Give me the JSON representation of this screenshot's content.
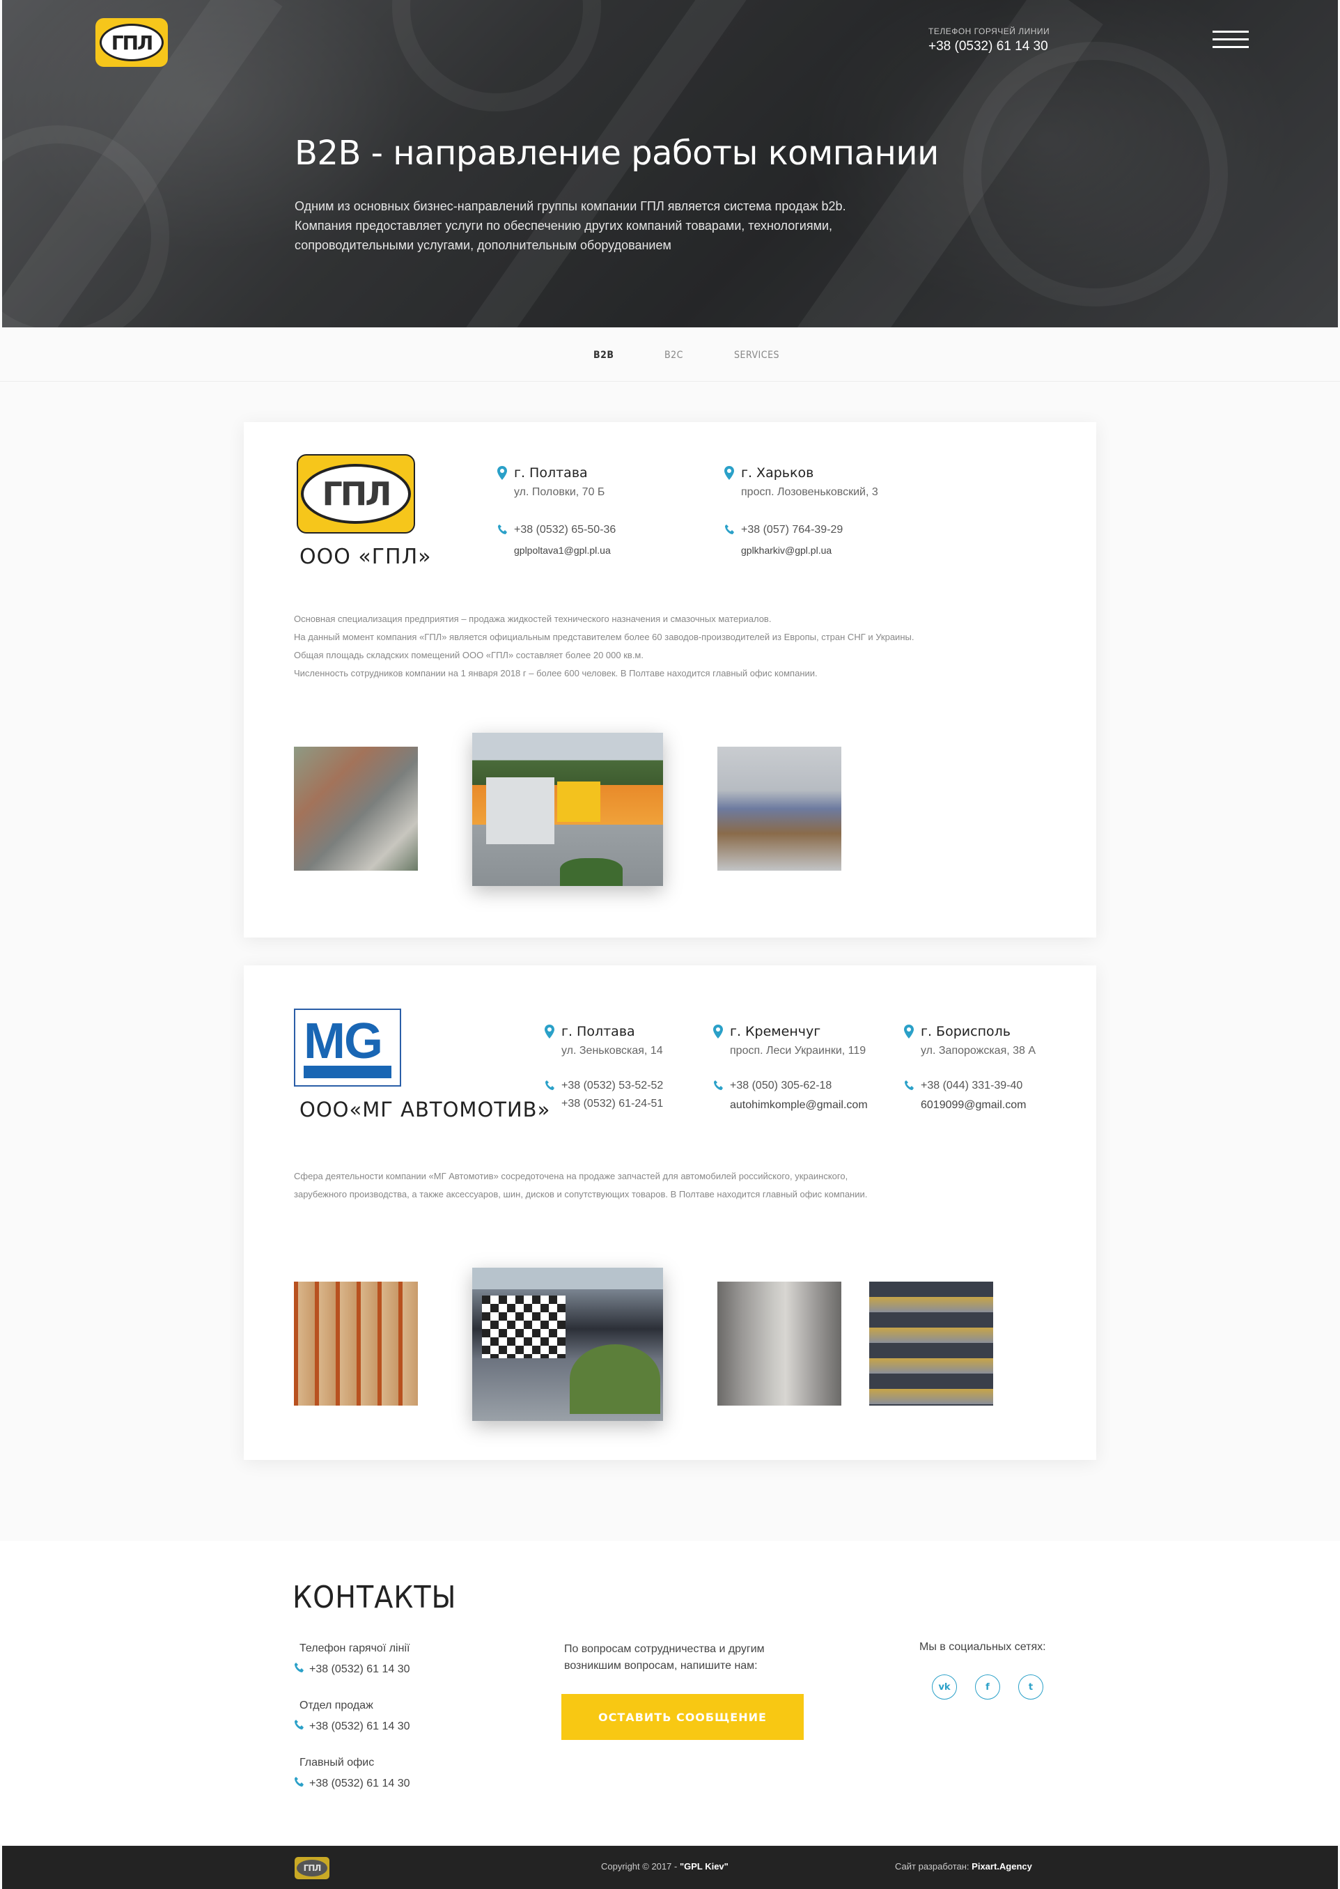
{
  "header": {
    "logo_text": "ГПЛ",
    "hotline_caption": "ТЕЛЕФОН ГОРЯЧЕЙ ЛИНИИ",
    "hotline_phone": "+38 (0532) 61 14 30",
    "title": "B2B - направление работы компании",
    "text": "Одним из основных бизнес-направлений группы компании ГПЛ является система продаж b2b. Компания предоставляет услуги по обеспечению других компаний товарами, технологиями, сопроводительными услугами, дополнительным оборудованием"
  },
  "tabs": [
    {
      "label": "B2B",
      "active": true
    },
    {
      "label": "B2C",
      "active": false
    },
    {
      "label": "SERVICES",
      "active": false
    }
  ],
  "company1": {
    "logo_text": "ГПЛ",
    "name": "ООО «ГПЛ»",
    "locations": [
      {
        "city": "г. Полтава",
        "address": "ул. Половки, 70 Б",
        "phone": "+38 (0532) 65-50-36",
        "email": "gplpoltava1@gpl.pl.ua"
      },
      {
        "city": "г. Харьков",
        "address": "просп. Лозовеньковский, 3",
        "phone": "+38 (057) 764-39-29",
        "email": "gplkharkiv@gpl.pl.ua"
      }
    ],
    "description": [
      "Основная специализация предприятия – продажа жидкостей технического назначения и смазочных материалов.",
      "На данный момент компания «ГПЛ» является официальным представителем более 60 заводов-производителей из Европы, стран СНГ и Украины.",
      "Общая площадь складских помещений ООО «ГПЛ» составляет более 20 000 кв.м.",
      "Численность сотрудников компании на 1 января 2018 г – более 600 человек. В Полтаве находится главный офис компании."
    ]
  },
  "company2": {
    "logo_text": "MG",
    "name": "ООО«МГ АВТОМОТИВ»",
    "locations": [
      {
        "city": "г. Полтава",
        "address": "ул. Зеньковская, 14",
        "phone": "+38 (0532) 53-52-52",
        "phone2": "+38 (0532) 61-24-51",
        "email": ""
      },
      {
        "city": "г. Кременчуг",
        "address": "просп. Леси Украинки, 119",
        "phone": "+38 (050)  305-62-18",
        "email": "autohimkomple@gmail.com"
      },
      {
        "city": "г. Борисполь",
        "address": "ул. Запорожская, 38 А",
        "phone": "+38 (044)  331-39-40",
        "email": "6019099@gmail.com"
      }
    ],
    "description": [
      "Сфера деятельности компании «МГ Автомотив» сосредоточена на продаже запчастей для автомобилей российского, украинского,",
      "зарубежного производства, а также аксессуаров, шин, дисков и сопутствующих товаров. В Полтаве находится главный офис компании."
    ]
  },
  "contacts": {
    "title": "КОНТАКТЫ",
    "groups": [
      {
        "label": "Телефон гарячої лінії",
        "phone": "+38 (0532) 61 14 30"
      },
      {
        "label": "Отдел продаж",
        "phone": "+38 (0532) 61 14 30"
      },
      {
        "label": "Главный офис",
        "phone": "+38 (0532) 61 14 30"
      }
    ],
    "coop_text": "По вопросам сотрудничества и другим возникшим вопросам, напишите нам:",
    "cta_label": "ОСТАВИТЬ СООБЩЕНИЕ",
    "social_caption": "Мы в социальных сетях:",
    "social": [
      "vk",
      "f",
      "t"
    ]
  },
  "footer": {
    "logo_text": "ГПЛ",
    "copyright_prefix": "Copyright © 2017 -",
    "copyright_brand": "\"GPL Kiev\"",
    "dev_prefix": "Сайт разработан:",
    "dev_brand": "Pixart.Agency"
  },
  "colors": {
    "brand_yellow": "#f6c61b",
    "accent_blue": "#2aa0c8",
    "mg_blue": "#1966b4",
    "footer_bg": "#232323"
  }
}
